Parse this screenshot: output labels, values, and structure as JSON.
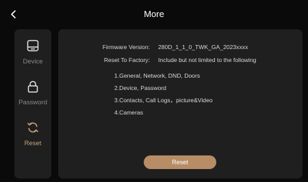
{
  "header": {
    "title": "More",
    "back_icon": "chevron-left-icon"
  },
  "sidebar": {
    "items": [
      {
        "label": "Device",
        "icon": "device-icon",
        "active": false
      },
      {
        "label": "Password",
        "icon": "lock-icon",
        "active": false
      },
      {
        "label": "Reset",
        "icon": "reset-icon",
        "active": true
      }
    ]
  },
  "panel": {
    "firmware_label": "Firmware Version:",
    "firmware_value": "280D_1_1_0_TWK_GA_2023xxxx",
    "reset_label": "Reset To Factory:",
    "reset_value": "Include but not limited to the following",
    "items": [
      "1.General, Network, DND, Doors",
      "2.Device, Password",
      "3.Contacts, Call Logs，picture&Video",
      "4.Cameras"
    ],
    "reset_button": "Reset"
  },
  "colors": {
    "background": "#0a0a0a",
    "panel": "#1f1f1f",
    "accent": "#b78d66",
    "accent_text": "#c9a37a",
    "inactive_text": "#8a8a8a"
  }
}
